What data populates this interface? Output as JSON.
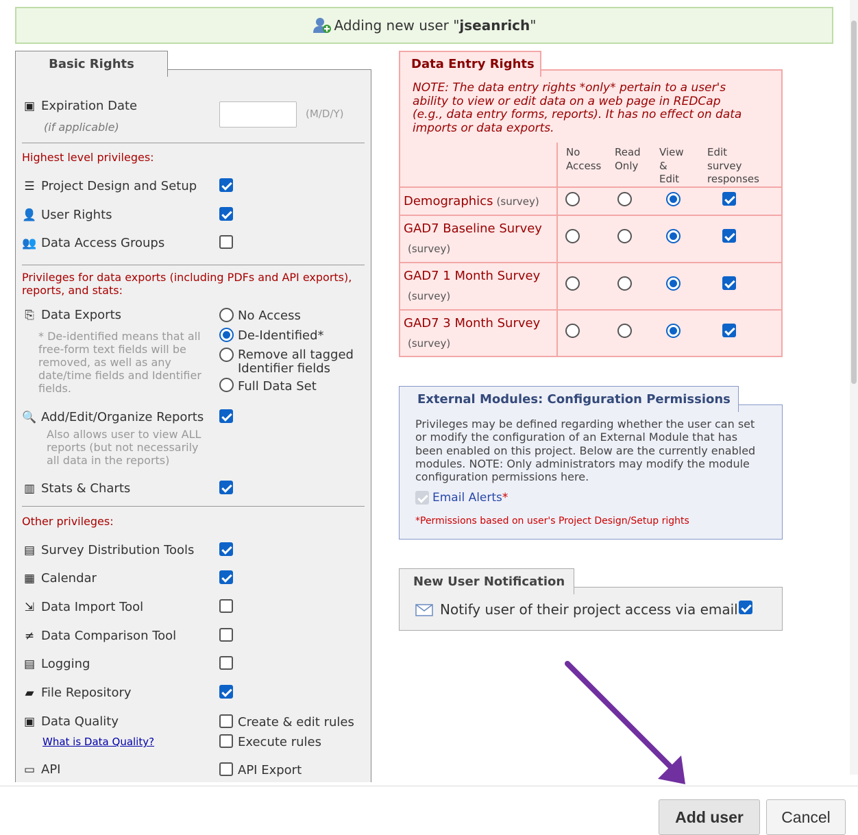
{
  "banner": {
    "prefix": "Adding new user \"",
    "username": "jseanrich",
    "suffix": "\""
  },
  "basic": {
    "tab": "Basic Rights",
    "expiration_label": "Expiration Date",
    "expiration_sub": "(if applicable)",
    "expiration_format": "(M/D/Y)",
    "expiration_value": "",
    "highest_title": "Highest level privileges:",
    "project_design": "Project Design and Setup",
    "project_design_checked": true,
    "user_rights": "User Rights",
    "user_rights_checked": true,
    "dag": "Data Access Groups",
    "dag_checked": false,
    "export_title": "Privileges for data exports (including PDFs and API exports), reports, and stats:",
    "data_exports": "Data Exports",
    "export_note": "* De-identified means that all free-form text fields will be removed, as well as any date/time fields and Identifier fields.",
    "export_options": [
      "No Access",
      "De-Identified*",
      "Remove all tagged Identifier fields",
      "Full Data Set"
    ],
    "export_selected": "De-Identified*",
    "reports": "Add/Edit/Organize Reports",
    "reports_checked": true,
    "reports_note": "Also allows user to view ALL reports (but not necessarily all data in the reports)",
    "stats": "Stats & Charts",
    "stats_checked": true,
    "other_title": "Other privileges:",
    "survey_tools": "Survey Distribution Tools",
    "survey_tools_checked": true,
    "calendar": "Calendar",
    "calendar_checked": true,
    "import": "Data Import Tool",
    "import_checked": false,
    "comparison": "Data Comparison Tool",
    "comparison_checked": false,
    "logging": "Logging",
    "logging_checked": false,
    "file_repo": "File Repository",
    "file_repo_checked": true,
    "dq": "Data Quality",
    "dq_link": "What is Data Quality?",
    "dq_create": "Create & edit rules",
    "dq_execute": "Execute rules",
    "api": "API",
    "api_export": "API Export"
  },
  "data_entry": {
    "tab": "Data Entry Rights",
    "note_lines": [
      "NOTE: The data entry rights *only* pertain to a user's",
      "ability to view or edit data on a web page in REDCap",
      "(e.g., data entry forms, reports). It has no effect on data",
      "imports or data exports."
    ],
    "col_no": [
      "No",
      "Access"
    ],
    "col_read": [
      "Read",
      "Only"
    ],
    "col_view": [
      "View",
      "&",
      "Edit"
    ],
    "col_edit": [
      "Edit",
      "survey",
      "responses"
    ],
    "survey_tag": "(survey)",
    "rows": [
      {
        "name": "Demographics",
        "selected": "View & Edit",
        "edit_responses": true
      },
      {
        "name": "GAD7 Baseline Survey",
        "selected": "View & Edit",
        "edit_responses": true
      },
      {
        "name": "GAD7 1 Month Survey",
        "selected": "View & Edit",
        "edit_responses": true
      },
      {
        "name": "GAD7 3 Month Survey",
        "selected": "View & Edit",
        "edit_responses": true
      }
    ]
  },
  "ext": {
    "tab": "External Modules: Configuration Permissions",
    "lines": [
      "Privileges may be defined regarding whether the user can set",
      "or modify the configuration of an External Module that has",
      "been enabled on this project. Below are the currently enabled",
      "modules. NOTE: Only administrators may modify the module",
      "configuration permissions here."
    ],
    "module": "Email Alerts",
    "star": "*",
    "module_checked": true,
    "footnote": "*Permissions based on user's Project Design/Setup rights"
  },
  "notify": {
    "tab": "New User Notification",
    "label": "Notify user of their project access via email?",
    "checked": true
  },
  "buttons": {
    "add": "Add user",
    "cancel": "Cancel"
  },
  "colors": {
    "accent": "#0d63c8",
    "arrow": "#7030a0"
  }
}
